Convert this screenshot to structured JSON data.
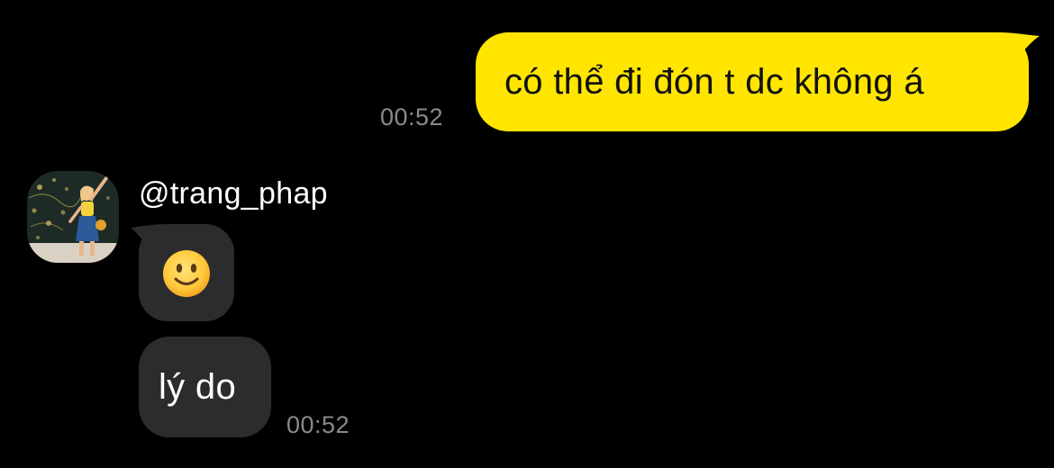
{
  "outgoing": {
    "text": "có thể đi đón t dc không á",
    "time": "00:52",
    "bubble_color": "#FFE500"
  },
  "incoming": {
    "sender": "@trang_phap",
    "avatar": "profile-photo",
    "messages": [
      {
        "type": "emoji",
        "emoji": "🙂",
        "icon": "slightly-smiling-face-icon"
      },
      {
        "type": "text",
        "text": "lý do"
      }
    ],
    "time": "00:52",
    "bubble_color": "#2C2C2E"
  },
  "timestamp_color": "#8A8A8A"
}
